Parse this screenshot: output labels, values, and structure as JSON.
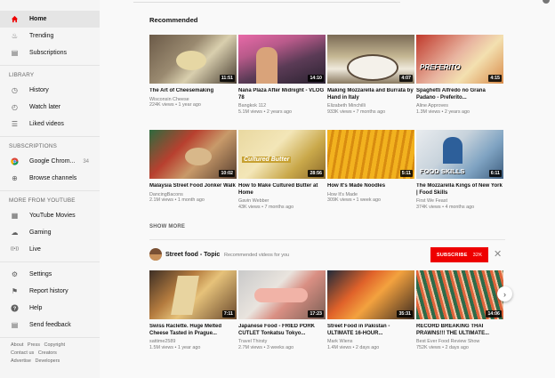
{
  "sidebar": {
    "main": [
      {
        "label": "Home",
        "icon": "home-icon",
        "glyph": "⌂"
      },
      {
        "label": "Trending",
        "icon": "trending-icon",
        "glyph": "♨"
      },
      {
        "label": "Subscriptions",
        "icon": "subscriptions-icon",
        "glyph": "▤"
      }
    ],
    "library_heading": "LIBRARY",
    "library": [
      {
        "label": "History",
        "icon": "history-icon",
        "glyph": "◷"
      },
      {
        "label": "Watch later",
        "icon": "watch-later-icon",
        "glyph": "◴"
      },
      {
        "label": "Liked videos",
        "icon": "liked-videos-icon",
        "glyph": "☰"
      }
    ],
    "subscriptions_heading": "SUBSCRIPTIONS",
    "subscriptions": [
      {
        "label": "Google Chrom...",
        "icon": "chrome-icon",
        "count": "34"
      },
      {
        "label": "Browse channels",
        "icon": "browse-channels-icon",
        "glyph": "⊕"
      }
    ],
    "more_heading": "MORE FROM YOUTUBE",
    "more": [
      {
        "label": "YouTube Movies",
        "icon": "movies-icon",
        "glyph": "▦"
      },
      {
        "label": "Gaming",
        "icon": "gaming-icon",
        "glyph": "☁"
      },
      {
        "label": "Live",
        "icon": "live-icon",
        "glyph": "((•))"
      }
    ],
    "settings": [
      {
        "label": "Settings",
        "icon": "settings-icon",
        "glyph": "⚙"
      },
      {
        "label": "Report history",
        "icon": "report-flag-icon",
        "glyph": "⚑"
      },
      {
        "label": "Help",
        "icon": "help-icon",
        "glyph": "?"
      },
      {
        "label": "Send feedback",
        "icon": "feedback-icon",
        "glyph": "▤"
      }
    ],
    "footer": {
      "line1": [
        "About",
        "Press",
        "Copyright"
      ],
      "line2": [
        "Contact us",
        "Creators"
      ],
      "line3": [
        "Advertise",
        "Developers"
      ]
    }
  },
  "recommended": {
    "title": "Recommended",
    "videos": [
      {
        "title": "The Art of Cheesemaking",
        "channel": "Wisconsin Cheese",
        "meta": "224K views • 1 year ago",
        "duration": "11:51"
      },
      {
        "title": "Nana Plaza After Midnight - VLOG 78",
        "channel": "Bangkok 112",
        "meta": "5.1M views • 2 years ago",
        "duration": "14:10"
      },
      {
        "title": "Making Mozzarella and Burrata by Hand in Italy",
        "channel": "Elizabeth Minchilli",
        "meta": "933K views • 7 months ago",
        "duration": "4:07"
      },
      {
        "title": "Spaghetti Alfredo no Grana Padano - Preferito...",
        "channel": "Aline Approves",
        "meta": "1.3M views • 2 years ago",
        "duration": "4:15",
        "overlay": "PREFERITO"
      },
      {
        "title": "Malaysia Street Food Jonker Walk",
        "channel": "DancingBacons",
        "meta": "2.1M views • 1 month ago",
        "duration": "10:02"
      },
      {
        "title": "How to Make Cultured Butter at Home",
        "channel": "Gavin Webber",
        "meta": "43K views • 7 months ago",
        "duration": "28:56",
        "overlay": "Cultured Butter"
      },
      {
        "title": "How It's Made Noodles",
        "channel": "How It's Made",
        "meta": "309K views • 1 week ago",
        "duration": "5:11"
      },
      {
        "title": "The Mozzarella Kings of New York | Food Skills",
        "channel": "First We Feast",
        "meta": "374K views • 4 months ago",
        "duration": "6:11",
        "overlay": "FOOD SKILLS"
      }
    ],
    "show_more": "SHOW MORE"
  },
  "shelf": {
    "title": "Street food - Topic",
    "subtitle": "Recommended videos for you",
    "subscribe_label": "SUBSCRIBE",
    "subscribe_count": "32K",
    "close_glyph": "✕",
    "next_glyph": "›",
    "videos": [
      {
        "title": "Swiss Raclette. Huge Melted Cheese Tasted in Prague...",
        "channel": "sattime2589",
        "meta": "1.5M views • 1 year ago",
        "duration": "7:11"
      },
      {
        "title": "Japanese Food - FRIED PORK CUTLET Tonkatsu Tokyo...",
        "channel": "Travel Thirsty",
        "meta": "2.7M views • 3 weeks ago",
        "duration": "17:23"
      },
      {
        "title": "Street Food in Pakistan - ULTIMATE 16-HOUR...",
        "channel": "Mark Wiens",
        "meta": "1.4M views • 2 days ago",
        "duration": "35:31"
      },
      {
        "title": "RECORD BREAKING THAI PRAWNS!!! THE ULTIMATE...",
        "channel": "Best Ever Food Review Show",
        "meta": "752K views • 2 days ago",
        "duration": "14:06"
      }
    ]
  },
  "colors": {
    "accent": "#ee0000",
    "sidebar_bg": "#f5f5f5",
    "page_bg": "#f9f9f9"
  }
}
